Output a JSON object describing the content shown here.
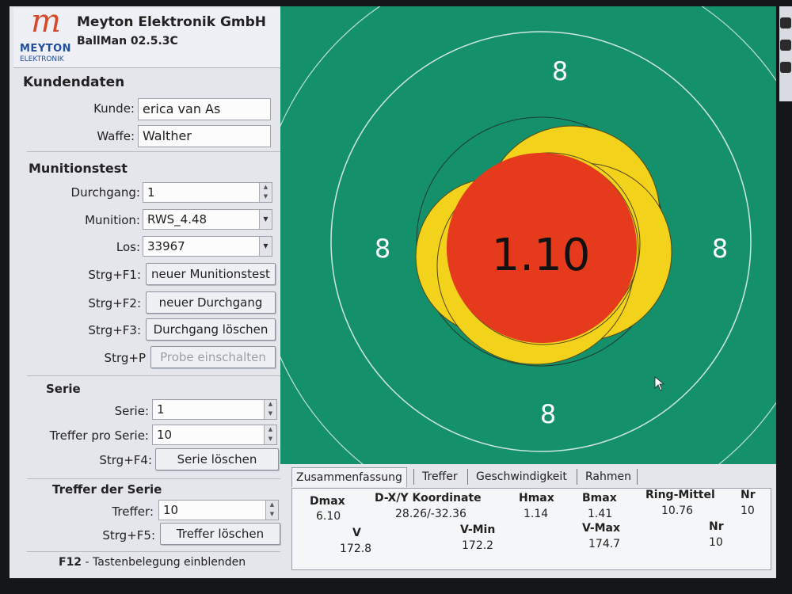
{
  "header": {
    "logo_mark": "m",
    "logo_text": "MEYTON",
    "logo_sub": "ELEKTRONIK",
    "company": "Meyton Elektronik GmbH",
    "product": "BallMan 02.5.3C"
  },
  "kundendaten": {
    "title": "Kundendaten",
    "kunde_label": "Kunde:",
    "kunde_value": "erica van As",
    "waffe_label": "Waffe:",
    "waffe_value": "Walther"
  },
  "munitionstest": {
    "title": "Munitionstest",
    "durchgang_label": "Durchgang:",
    "durchgang_value": "1",
    "munition_label": "Munition:",
    "munition_value": "RWS_4.48",
    "los_label": "Los:",
    "los_value": "33967",
    "shortcuts": [
      {
        "key": "Strg+F1:",
        "label": "neuer Munitionstest",
        "enabled": true
      },
      {
        "key": "Strg+F2:",
        "label": "neuer Durchgang",
        "enabled": true
      },
      {
        "key": "Strg+F3:",
        "label": "Durchgang löschen",
        "enabled": true
      },
      {
        "key": "Strg+P",
        "label": "Probe einschalten",
        "enabled": false
      }
    ]
  },
  "serie": {
    "title": "Serie",
    "serie_label": "Serie:",
    "serie_value": "1",
    "treffer_label": "Treffer pro Serie:",
    "treffer_value": "10",
    "key": "Strg+F4:",
    "button": "Serie löschen"
  },
  "treffer_serie": {
    "title": "Treffer der Serie",
    "treffer_label": "Treffer:",
    "treffer_value": "10",
    "key": "Strg+F5:",
    "button": "Treffer löschen"
  },
  "footer": {
    "key": "F12",
    "text": " - Tastenbelegung einblenden"
  },
  "target": {
    "center_value": "1.10",
    "ring_labels": [
      "8",
      "8",
      "8",
      "8"
    ],
    "background_color": "#14916a",
    "hit_fill": "#f2d21b",
    "center_fill": "#e63a1c"
  },
  "tabs": [
    "Zusammenfassung",
    "Treffer",
    "Geschwindigkeit",
    "Rahmen"
  ],
  "summary": {
    "dmax_label": "Dmax",
    "dmax_value": "6.10",
    "dxy_label": "D-X/Y Koordinate",
    "dxy_value": "28.26/-32.36",
    "hmax_label": "Hmax",
    "hmax_value": "1.14",
    "bmax_label": "Bmax",
    "bmax_value": "1.41",
    "ring_label": "Ring-Mittel",
    "ring_value": "10.76",
    "nr1_label": "Nr",
    "nr1_value": "10",
    "v_label": "V",
    "v_value": "172.8",
    "vmin_label": "V-Min",
    "vmin_value": "172.2",
    "vmax_label": "V-Max",
    "vmax_value": "174.7",
    "nr2_label": "Nr",
    "nr2_value": "10"
  }
}
